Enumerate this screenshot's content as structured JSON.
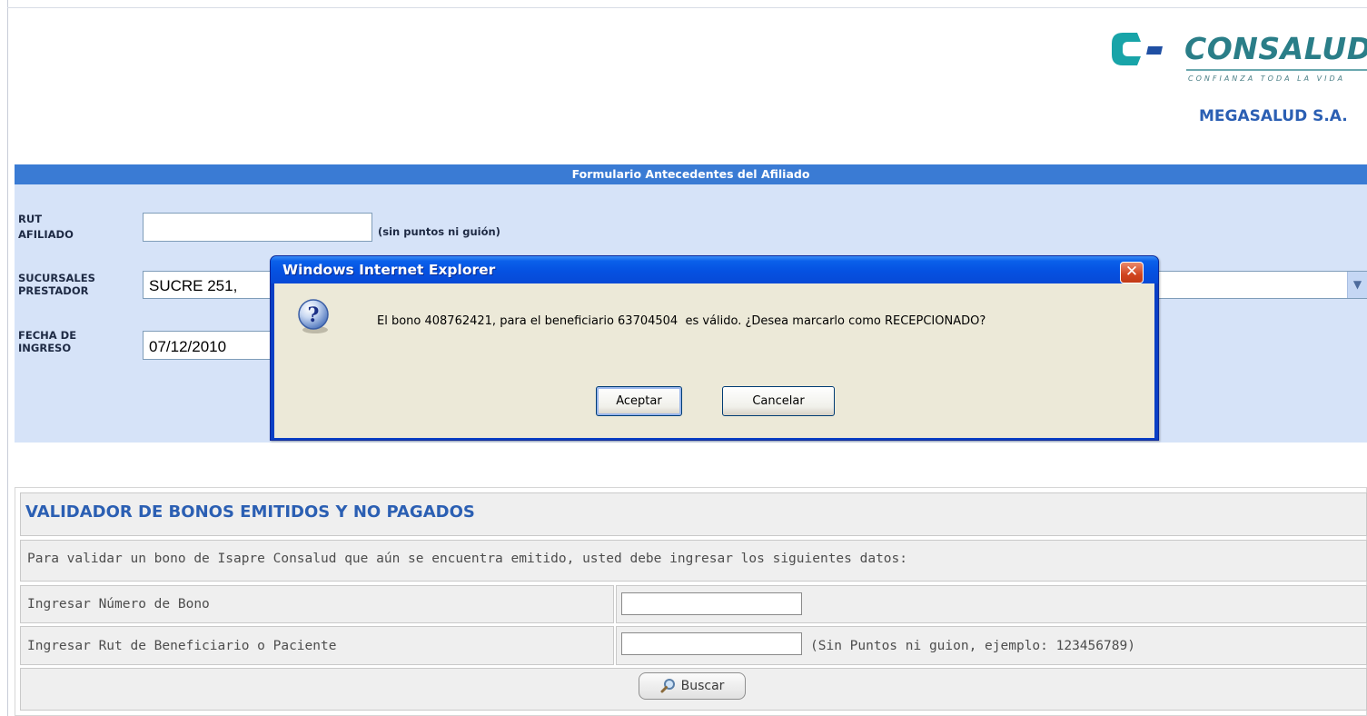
{
  "header": {
    "logo_name": "CONSALUD",
    "logo_tagline": "CONFIANZA TODA LA VIDA",
    "prestador": "MEGASALUD S.A."
  },
  "form": {
    "title": "Formulario Antecedentes del Afiliado",
    "rut_label_1": "RUT",
    "rut_label_2": "AFILIADO",
    "rut_value": "",
    "rut_hint": "(sin puntos ni guión)",
    "sucursales_label_1": "SUCURSALES",
    "sucursales_label_2": "PRESTADOR",
    "sucursal_selected": "SUCRE 251,",
    "fecha_label_1": "FECHA DE",
    "fecha_label_2": "INGRESO",
    "fecha_value": "07/12/2010"
  },
  "validator": {
    "title": "VALIDADOR DE BONOS EMITIDOS Y NO PAGADOS",
    "instructions": "Para validar un bono de Isapre Consalud que aún se encuentra emitido, usted debe ingresar los siguientes datos:",
    "bono_label": "Ingresar Número de Bono",
    "bono_value": "",
    "rut_label": "Ingresar Rut de Beneficiario o Paciente",
    "rut_value": "",
    "rut_hint": "(Sin Puntos ni guion, ejemplo: 123456789)",
    "search_label": "Buscar"
  },
  "dialog": {
    "title": "Windows Internet Explorer",
    "message": "El bono 408762421, para el beneficiario 63704504  es válido. ¿Desea marcarlo como RECEPCIONADO?",
    "ok_label": "Aceptar",
    "cancel_label": "Cancelar",
    "close_glyph": "✕"
  },
  "colors": {
    "form_header": "#3a7bd4",
    "form_body": "#d6e3f8",
    "title_blue": "#2b5fb3",
    "dialog_title": "#0551e1",
    "dialog_body": "#ece9d8",
    "close_button": "#d1451f"
  },
  "icons": {
    "dialog": "question-icon",
    "search": "magnifier-icon",
    "select": "chevron-down-icon"
  }
}
